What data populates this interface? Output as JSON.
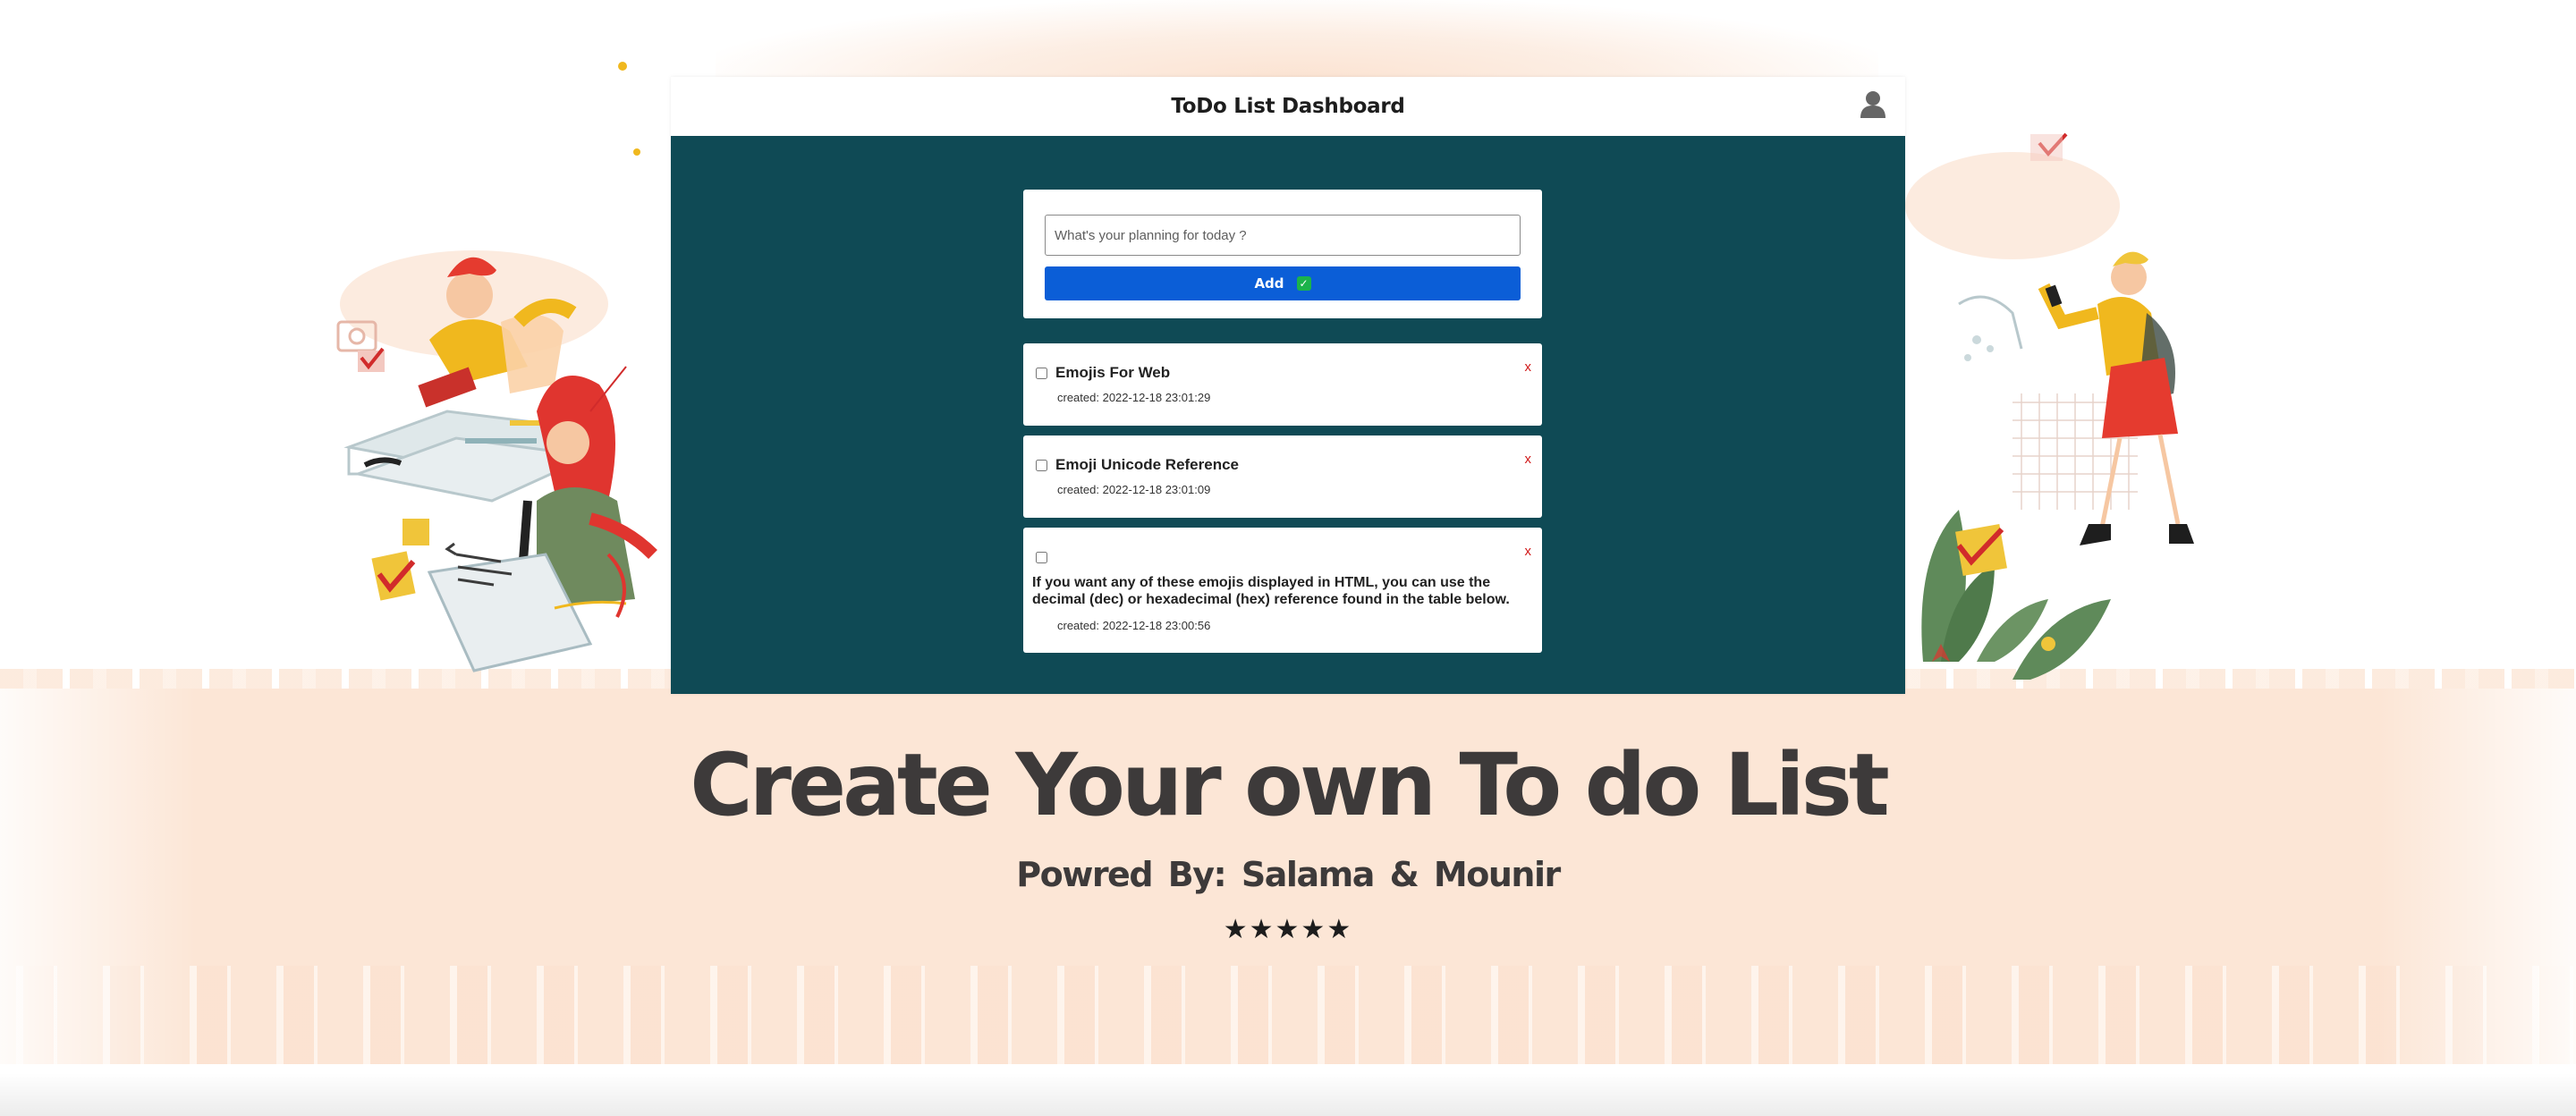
{
  "header": {
    "title": "ToDo List Dashboard",
    "user_icon": "user-icon"
  },
  "entry": {
    "placeholder": "What's your planning for today ?",
    "value": "",
    "add_label": "Add",
    "add_icon": "check-mark-button-icon"
  },
  "todos": [
    {
      "title": "Emojis For Web",
      "created": "created: 2022-12-18 23:01:29",
      "checked": false,
      "delete_label": "x"
    },
    {
      "title": "Emoji Unicode Reference",
      "created": "created: 2022-12-18 23:01:09",
      "checked": false,
      "delete_label": "x"
    },
    {
      "title": "If you want any of these emojis displayed in HTML, you can use the decimal (dec) or hexadecimal (hex) reference found in the table below.",
      "created": "created: 2022-12-18 23:00:56",
      "checked": false,
      "delete_label": "x"
    }
  ],
  "hero": {
    "title": "Create Your own To do List",
    "powered_by": "Powred By:  Salama & Mounir",
    "rating": "★★★★★"
  },
  "colors": {
    "panel": "#0f4a55",
    "add_button": "#0b5ed7",
    "band": "#fce6d6",
    "heading_text": "#3d3a3a",
    "delete_x": "#d11a1a"
  }
}
